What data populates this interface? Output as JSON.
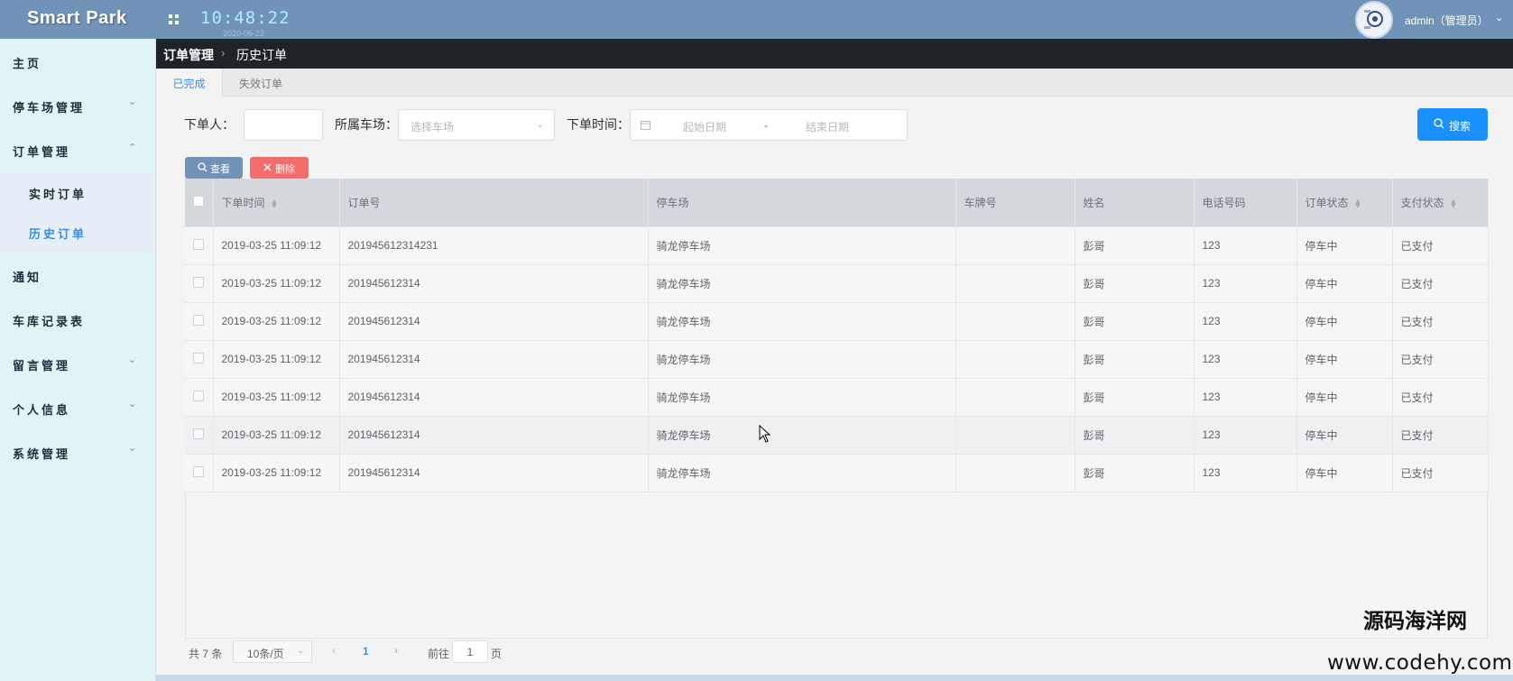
{
  "header": {
    "brand": "Smart Park",
    "clock": "10:48:22",
    "date": "2020-06-22",
    "user": "admin（管理员）"
  },
  "sidebar": {
    "items": [
      {
        "label": "主页"
      },
      {
        "label": "停车场管理"
      },
      {
        "label": "订单管理"
      },
      {
        "label": "实时订单"
      },
      {
        "label": "历史订单"
      },
      {
        "label": "通知"
      },
      {
        "label": "车库记录表"
      },
      {
        "label": "留言管理"
      },
      {
        "label": "个人信息"
      },
      {
        "label": "系统管理"
      }
    ]
  },
  "breadcrumb": {
    "level1": "订单管理",
    "level2": "历史订单"
  },
  "tabs": [
    {
      "label": "已完成"
    },
    {
      "label": "失效订单"
    }
  ],
  "search": {
    "orderer_label": "下单人：",
    "parking_label": "所属车场：",
    "parking_placeholder": "选择车场",
    "time_label": "下单时间：",
    "start_placeholder": "起始日期",
    "range_sep": "-",
    "end_placeholder": "结束日期",
    "search_button": "搜索"
  },
  "toolbar": {
    "view_button": "查看",
    "delete_button": "删除"
  },
  "table": {
    "columns": [
      "下单时间",
      "订单号",
      "停车场",
      "车牌号",
      "姓名",
      "电话号码",
      "订单状态",
      "支付状态"
    ],
    "rows": [
      {
        "time": "2019-03-25 11:09:12",
        "order_no": "201945612314231",
        "lot": "骑龙停车场",
        "plate": "",
        "name": "彭哥",
        "phone": "123",
        "status": "停车中",
        "pay": "已支付"
      },
      {
        "time": "2019-03-25 11:09:12",
        "order_no": "201945612314",
        "lot": "骑龙停车场",
        "plate": "",
        "name": "彭哥",
        "phone": "123",
        "status": "停车中",
        "pay": "已支付"
      },
      {
        "time": "2019-03-25 11:09:12",
        "order_no": "201945612314",
        "lot": "骑龙停车场",
        "plate": "",
        "name": "彭哥",
        "phone": "123",
        "status": "停车中",
        "pay": "已支付"
      },
      {
        "time": "2019-03-25 11:09:12",
        "order_no": "201945612314",
        "lot": "骑龙停车场",
        "plate": "",
        "name": "彭哥",
        "phone": "123",
        "status": "停车中",
        "pay": "已支付"
      },
      {
        "time": "2019-03-25 11:09:12",
        "order_no": "201945612314",
        "lot": "骑龙停车场",
        "plate": "",
        "name": "彭哥",
        "phone": "123",
        "status": "停车中",
        "pay": "已支付"
      },
      {
        "time": "2019-03-25 11:09:12",
        "order_no": "201945612314",
        "lot": "骑龙停车场",
        "plate": "",
        "name": "彭哥",
        "phone": "123",
        "status": "停车中",
        "pay": "已支付"
      },
      {
        "time": "2019-03-25 11:09:12",
        "order_no": "201945612314",
        "lot": "骑龙停车场",
        "plate": "",
        "name": "彭哥",
        "phone": "123",
        "status": "停车中",
        "pay": "已支付"
      }
    ]
  },
  "pagination": {
    "total": "共 7 条",
    "page_size": "10条/页",
    "prev": "‹",
    "current": "1",
    "next": "›",
    "goto_label": "前往",
    "goto_value": "1",
    "page_unit": "页"
  },
  "watermark": {
    "line1": "源码海洋网",
    "line2": "www.codehy.com"
  },
  "colors": {
    "header": "#7193b7",
    "sidebar": "#e1f4f5",
    "accent": "#1890ff",
    "danger": "#f56c6c",
    "active_link": "#3a8ee6"
  },
  "icons": [
    "grid-icon",
    "chevron-down-icon",
    "chevron-up-icon",
    "search-icon",
    "close-icon",
    "calendar-icon",
    "sort-icon",
    "cursor-icon"
  ]
}
